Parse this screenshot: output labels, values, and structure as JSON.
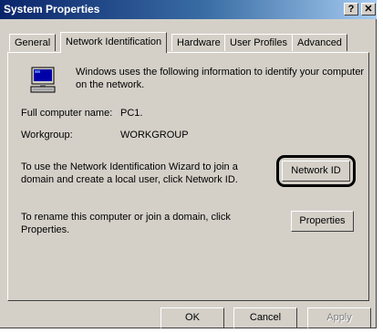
{
  "window": {
    "title": "System Properties",
    "help_label": "?",
    "close_label": "✕"
  },
  "tabs": [
    {
      "label": "General",
      "active": false
    },
    {
      "label": "Network Identification",
      "active": true
    },
    {
      "label": "Hardware",
      "active": false
    },
    {
      "label": "User Profiles",
      "active": false
    },
    {
      "label": "Advanced",
      "active": false
    }
  ],
  "panel": {
    "intro_line1": "Windows uses the following information to identify your computer",
    "intro_line2": "on the network.",
    "full_name_label": "Full computer name:",
    "full_name_value": "PC1.",
    "workgroup_label": "Workgroup:",
    "workgroup_value": "WORKGROUP",
    "wizard_line1": "To use the Network Identification Wizard to join a",
    "wizard_line2": "domain and create a local user, click Network ID.",
    "network_id_button": "Network ID",
    "rename_line1": "To rename this computer or join a domain, click",
    "rename_line2": "Properties.",
    "properties_button": "Properties"
  },
  "buttons": {
    "ok": "OK",
    "cancel": "Cancel",
    "apply": "Apply"
  },
  "icons": {
    "computer": "computer-icon"
  }
}
